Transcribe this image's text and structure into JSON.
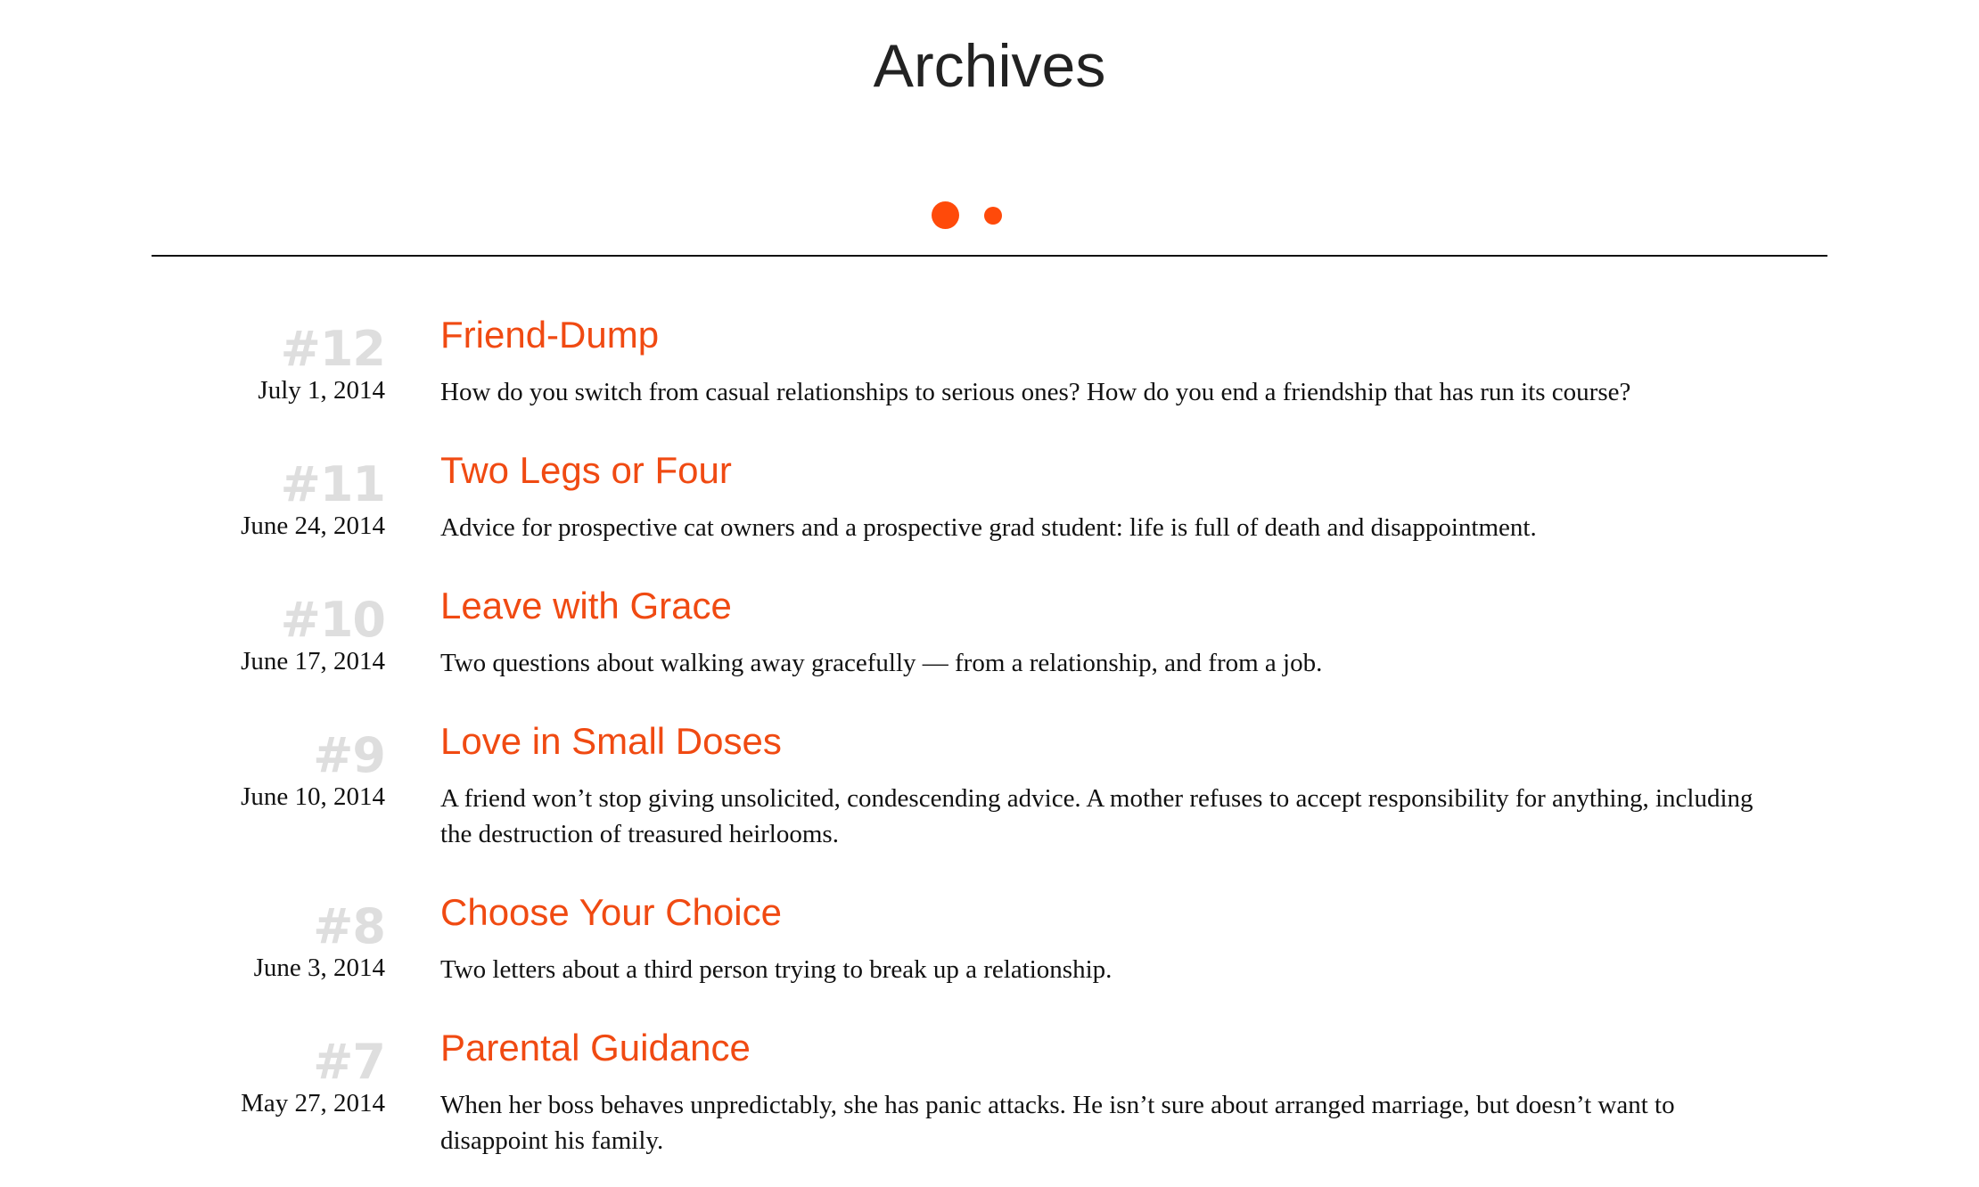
{
  "page": {
    "title": "Archives"
  },
  "colors": {
    "accent": "#F04A12",
    "dot": "#FF4A0A",
    "number": "#DEDEDE",
    "text": "#111111",
    "rule": "#111111"
  },
  "pagination_dots": [
    {
      "name": "page-dot-1",
      "active": true
    },
    {
      "name": "page-dot-2",
      "active": false
    }
  ],
  "entries": [
    {
      "number": "#12",
      "title": "Friend-Dump",
      "date": "July 1, 2014",
      "description": "How do you switch from casual relationships to serious ones? How do you end a friendship that has run its course?"
    },
    {
      "number": "#11",
      "title": "Two Legs or Four",
      "date": "June 24, 2014",
      "description": "Advice for prospective cat owners and a prospective grad student: life is full of death and disappointment."
    },
    {
      "number": "#10",
      "title": "Leave with Grace",
      "date": "June 17, 2014",
      "description": "Two questions about walking away gracefully — from a relationship, and from a job."
    },
    {
      "number": "#9",
      "title": "Love in Small Doses",
      "date": "June 10, 2014",
      "description": "A friend won’t stop giving unsolicited, condescending advice. A mother refuses to accept responsibility for anything, including the destruction of treasured heirlooms."
    },
    {
      "number": "#8",
      "title": "Choose Your Choice",
      "date": "June 3, 2014",
      "description": "Two letters about a third person trying to break up a relationship."
    },
    {
      "number": "#7",
      "title": "Parental Guidance",
      "date": "May 27, 2014",
      "description": "When her boss behaves unpredictably, she has panic attacks. He isn’t sure about arranged marriage, but doesn’t want to disappoint his family."
    }
  ]
}
